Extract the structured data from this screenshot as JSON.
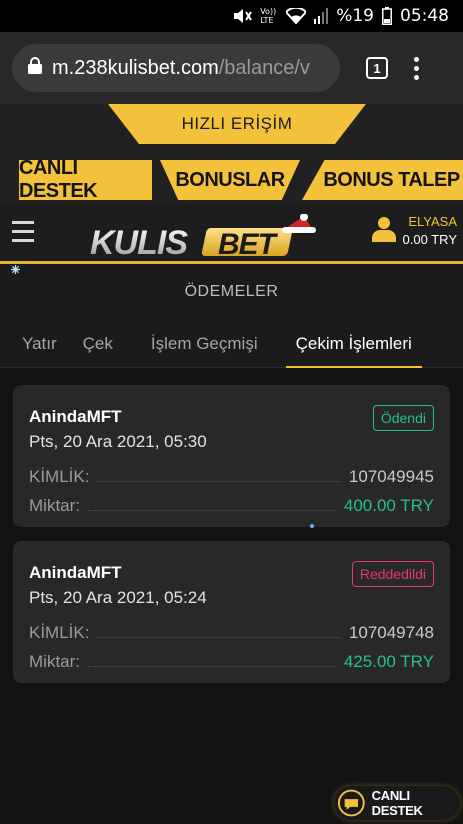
{
  "status_bar": {
    "network_label": "Vo)) LTE",
    "battery_percent": "%19",
    "time": "05:48"
  },
  "browser": {
    "url_host": "m.238kulisbet.com",
    "url_path": "/balance/v",
    "tab_count": "1"
  },
  "quick_access": {
    "title": "HIZLI ERİŞİM",
    "buttons": [
      "CANLI DESTEK",
      "BONUSLAR",
      "BONUS TALEP"
    ]
  },
  "header": {
    "logo_text": "KULISBET",
    "username": "ELYASA",
    "balance": "0.00 TRY"
  },
  "page": {
    "title": "ÖDEMELER",
    "tabs": [
      {
        "label": "Yatır",
        "active": false
      },
      {
        "label": "Çek",
        "active": false
      },
      {
        "label": "İşlem Geçmişi",
        "active": false
      },
      {
        "label": "Çekim İşlemleri",
        "active": true
      }
    ]
  },
  "withdrawals": [
    {
      "method": "AnindaMFT",
      "date": "Pts, 20 Ara 2021, 05:30",
      "status": "Ödendi",
      "status_color": "#27c08a",
      "id_label": "KİMLİK:",
      "id_value": "107049945",
      "amount_label": "Miktar:",
      "amount_value": "400.00 TRY"
    },
    {
      "method": "AnindaMFT",
      "date": "Pts, 20 Ara 2021, 05:24",
      "status": "Reddedildi",
      "status_color": "#e43c6c",
      "id_label": "KİMLİK:",
      "id_value": "107049748",
      "amount_label": "Miktar:",
      "amount_value": "425.00 TRY"
    }
  ],
  "support_fab": {
    "label": "CANLI DESTEK"
  },
  "colors": {
    "accent": "#f3c13a",
    "success": "#27c08a",
    "danger": "#e43c6c",
    "background": "#121212",
    "card": "#282828"
  },
  "icons": [
    "mute-icon",
    "wifi-icon",
    "signal-icon",
    "battery-icon",
    "lock-icon",
    "tabs-icon",
    "menu-kebab-icon",
    "hamburger-icon",
    "user-icon",
    "snowflake-icon",
    "chat-support-icon"
  ]
}
